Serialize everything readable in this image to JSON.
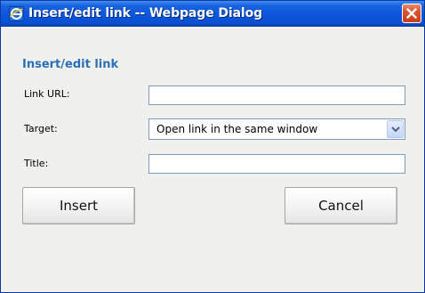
{
  "window": {
    "title": "Insert/edit link -- Webpage Dialog",
    "icons": {
      "app": "internet-explorer-icon",
      "close": "close-icon"
    },
    "colors": {
      "titlebar": "#0b55dc",
      "close_button": "#d8542c",
      "background": "#f0f0ee",
      "heading": "#2b6fb6"
    }
  },
  "dialog": {
    "heading": "Insert/edit link",
    "fields": {
      "url": {
        "label": "Link URL:",
        "value": ""
      },
      "target": {
        "label": "Target:",
        "selected": "Open link in the same window",
        "arrow_icon": "chevron-down-icon"
      },
      "title": {
        "label": "Title:",
        "value": ""
      }
    },
    "buttons": {
      "insert": "Insert",
      "cancel": "Cancel"
    }
  }
}
